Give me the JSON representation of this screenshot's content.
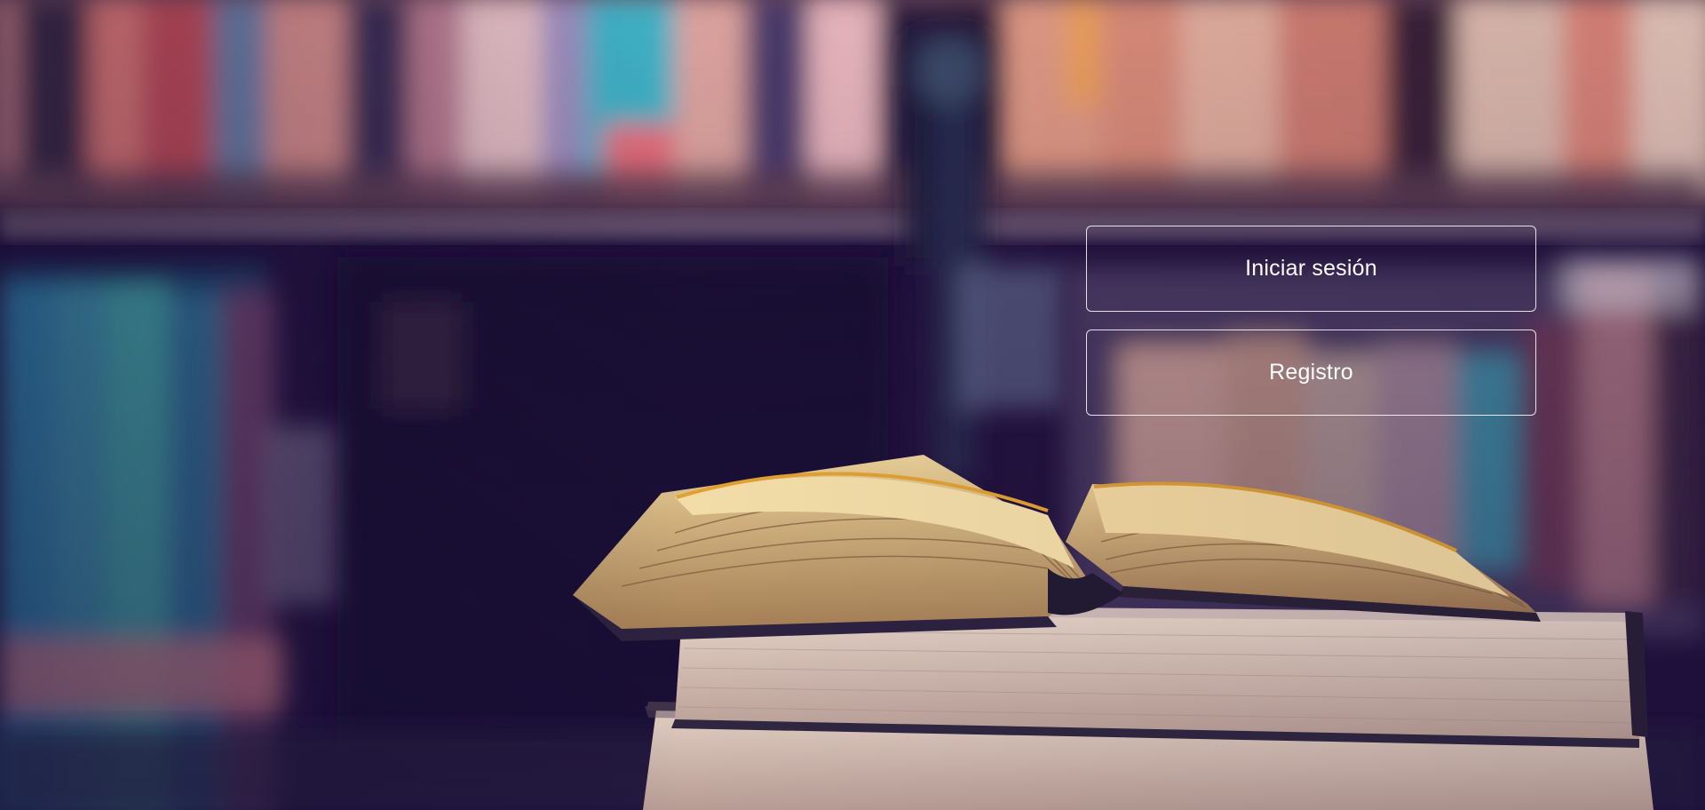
{
  "background": {
    "scene": "blurred-library-bookshelf-with-open-book",
    "base_color": "#1c0f3a",
    "accent_colors": [
      "#e26c6c",
      "#3fa6b9",
      "#f0a35a",
      "#d9c39a"
    ]
  },
  "auth": {
    "login_label": "Iniciar sesión",
    "register_label": "Registro",
    "button_border_color": "#ffffff",
    "button_text_color": "#ffffff"
  }
}
